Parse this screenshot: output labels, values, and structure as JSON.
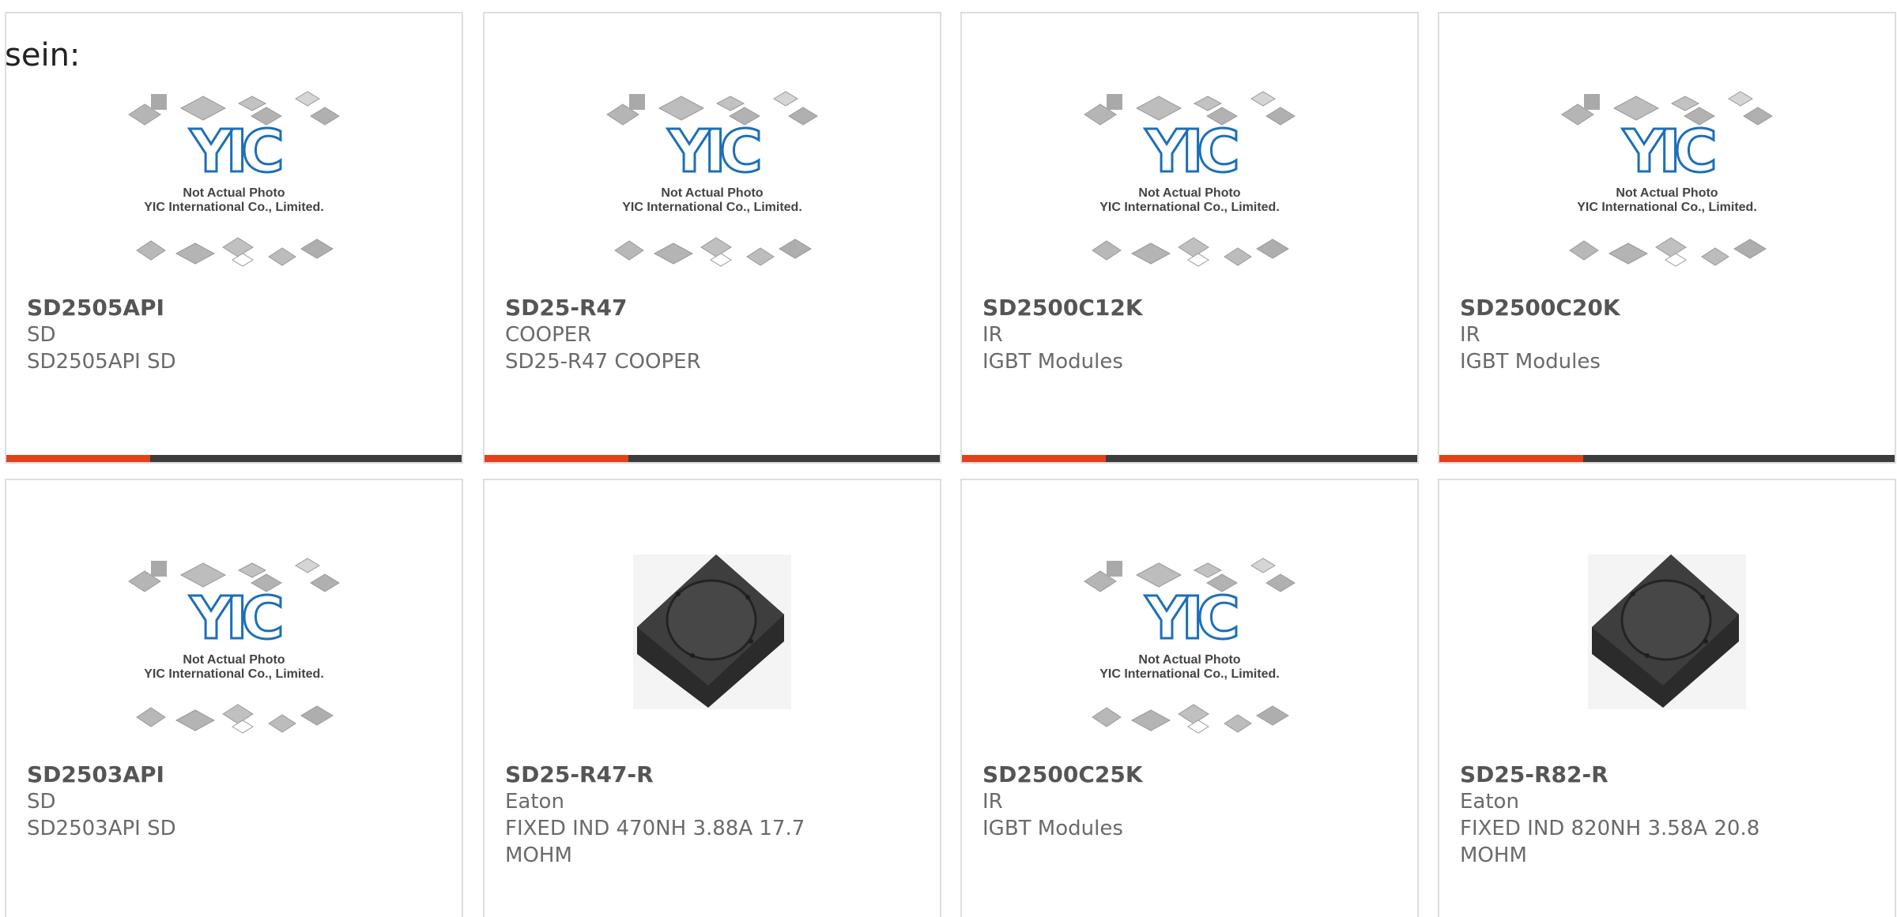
{
  "intro_text": "sein:",
  "placeholder_caption": {
    "line1": "Not Actual Photo",
    "line2": "YIC International Co., Limited.",
    "logo_text": "YIC"
  },
  "colors": {
    "accent_bar": "#e4411b",
    "dark_bar": "#3c3c3c",
    "logo_blue": "#1d6fb8",
    "card_border": "#dedede"
  },
  "products": [
    {
      "part_number": "SD2505API",
      "manufacturer": "SD",
      "description": "SD2505API SD",
      "image": "placeholder"
    },
    {
      "part_number": "SD25-R47",
      "manufacturer": "COOPER",
      "description": "SD25-R47 COOPER",
      "image": "placeholder"
    },
    {
      "part_number": "SD2500C12K",
      "manufacturer": "IR",
      "description": "IGBT Modules",
      "image": "placeholder"
    },
    {
      "part_number": "SD2500C20K",
      "manufacturer": "IR",
      "description": "IGBT Modules",
      "image": "placeholder"
    },
    {
      "part_number": "SD2503API",
      "manufacturer": "SD",
      "description": "SD2503API SD",
      "image": "placeholder"
    },
    {
      "part_number": "SD25-R47-R",
      "manufacturer": "Eaton",
      "description": "FIXED IND 470NH 3.88A 17.7 MOHM",
      "image": "inductor"
    },
    {
      "part_number": "SD2500C25K",
      "manufacturer": "IR",
      "description": "IGBT Modules",
      "image": "placeholder"
    },
    {
      "part_number": "SD25-R82-R",
      "manufacturer": "Eaton",
      "description": "FIXED IND 820NH 3.58A 20.8 MOHM",
      "image": "inductor"
    }
  ]
}
